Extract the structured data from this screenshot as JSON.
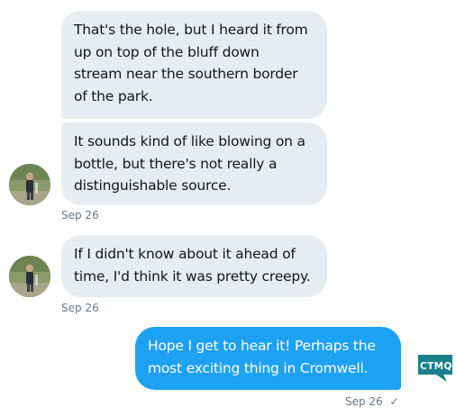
{
  "conversation": {
    "groups": [
      {
        "messages": [
          "That's the hole, but I heard it from\nup on top of the bluff down\nstream near the southern border\nof the park.",
          "It sounds kind of like blowing on a\nbottle, but there's not really a\ndistinguishable source."
        ],
        "timestamp": "Sep 26"
      },
      {
        "messages": [
          "If I didn't know about it ahead of\ntime, I'd think it was pretty creepy."
        ],
        "timestamp": "Sep 26"
      }
    ],
    "my_message": {
      "text": "Hope I get to hear it!  Perhaps the\nmost exciting thing in Cromwell.",
      "timestamp": "Sep 26",
      "status_icon": "checkmark-icon",
      "status_glyph": "✓"
    },
    "my_brand": {
      "logo_text": "CTMQ",
      "color": "#1a7f8a"
    }
  },
  "colors": {
    "received_bubble": "#e6ecf0",
    "sent_bubble": "#1da1f2",
    "meta_text": "#657786"
  }
}
